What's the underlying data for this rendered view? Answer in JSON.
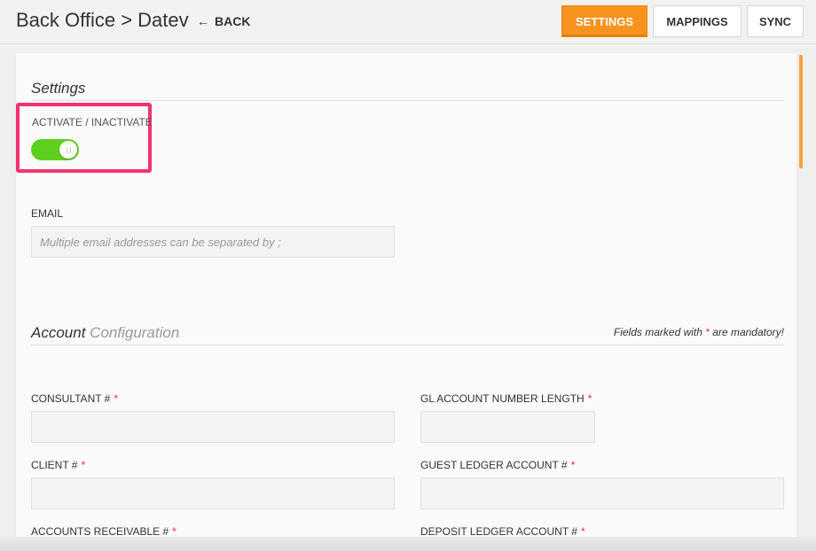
{
  "header": {
    "title": "Back Office > Datev",
    "back_arrow": "←",
    "back_label": "BACK",
    "tabs": [
      {
        "label": "SETTINGS",
        "active": true
      },
      {
        "label": "MAPPINGS",
        "active": false
      },
      {
        "label": "SYNC",
        "active": false
      }
    ],
    "accent_color": "#f7931e"
  },
  "settings": {
    "section_title": "Settings",
    "activate_label": "ACTIVATE / INACTIVATE",
    "activate_on": true,
    "toggle_color": "#5fcf1f",
    "email_label": "EMAIL",
    "email_placeholder": "Multiple email addresses can be separated by ;",
    "email_value": ""
  },
  "account": {
    "title_main": "Account",
    "title_sub": "Configuration",
    "mandatory_prefix": "Fields marked with",
    "mandatory_star": "*",
    "mandatory_suffix": "are mandatory!",
    "fields": {
      "consultant": {
        "label": "CONSULTANT #",
        "required": "*",
        "value": ""
      },
      "gl_length": {
        "label": "GL ACCOUNT NUMBER LENGTH",
        "required": "*",
        "value": ""
      },
      "client": {
        "label": "CLIENT #",
        "required": "*",
        "value": ""
      },
      "guest_ledger": {
        "label": "GUEST LEDGER ACCOUNT #",
        "required": "*",
        "value": ""
      },
      "accounts_receivable": {
        "label": "ACCOUNTS RECEIVABLE #",
        "required": "*"
      },
      "deposit_ledger": {
        "label": "DEPOSIT LEDGER ACCOUNT #",
        "required": "*"
      }
    }
  }
}
